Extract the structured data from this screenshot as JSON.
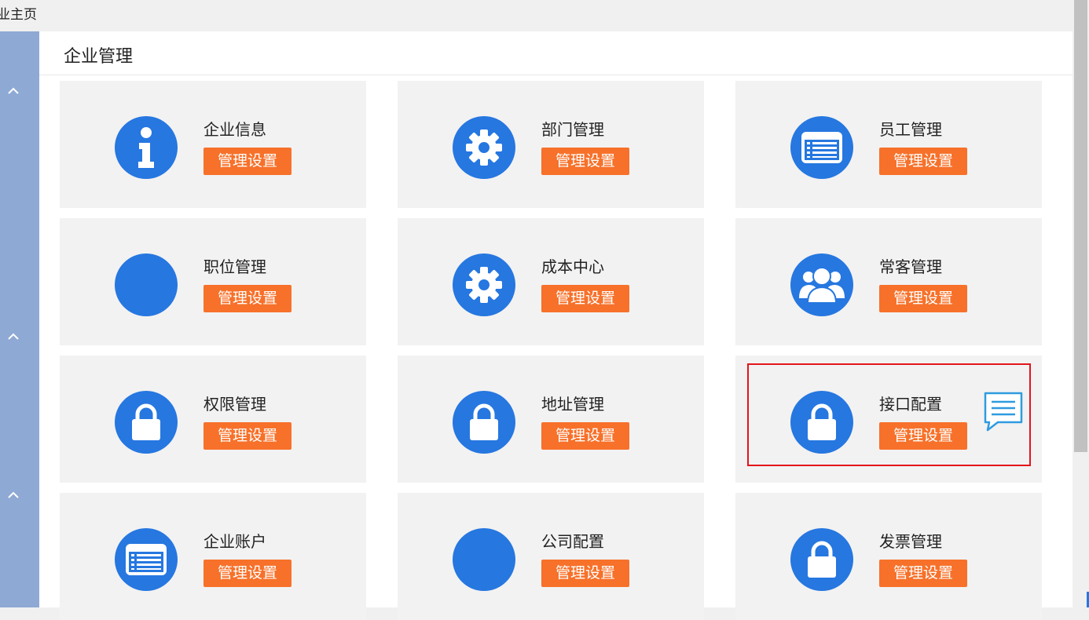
{
  "breadcrumb": "业主页",
  "page_title": "企业管理",
  "accent_color": "#2677e0",
  "button_color": "#f7712a",
  "cards": [
    {
      "label": "企业信息",
      "icon": "info-icon",
      "button": "管理设置"
    },
    {
      "label": "部门管理",
      "icon": "gear-icon",
      "button": "管理设置"
    },
    {
      "label": "员工管理",
      "icon": "list-card-icon",
      "button": "管理设置"
    },
    {
      "label": "职位管理",
      "icon": "blank-icon",
      "button": "管理设置"
    },
    {
      "label": "成本中心",
      "icon": "gear-icon",
      "button": "管理设置"
    },
    {
      "label": "常客管理",
      "icon": "users-icon",
      "button": "管理设置"
    },
    {
      "label": "权限管理",
      "icon": "lock-icon",
      "button": "管理设置"
    },
    {
      "label": "地址管理",
      "icon": "lock-icon",
      "button": "管理设置"
    },
    {
      "label": "接口配置",
      "icon": "lock-icon",
      "button": "管理设置"
    },
    {
      "label": "企业账户",
      "icon": "list-card-icon",
      "button": "管理设置"
    },
    {
      "label": "公司配置",
      "icon": "blank-icon",
      "button": "管理设置"
    },
    {
      "label": "发票管理",
      "icon": "lock-icon",
      "button": "管理设置"
    }
  ]
}
